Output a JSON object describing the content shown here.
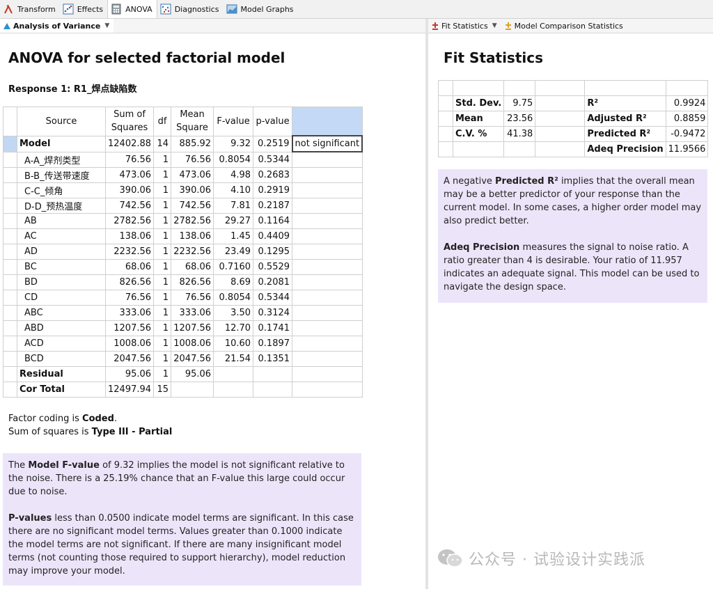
{
  "toolbar": {
    "items": [
      {
        "label": "Transform",
        "icon": "lambda-icon"
      },
      {
        "label": "Effects",
        "icon": "effects-plot-icon"
      },
      {
        "label": "ANOVA",
        "icon": "calculator-icon"
      },
      {
        "label": "Diagnostics",
        "icon": "diagnostics-icon"
      },
      {
        "label": "Model Graphs",
        "icon": "model-graphs-icon"
      }
    ],
    "active": "ANOVA"
  },
  "left_tab": {
    "label": "Analysis of Variance"
  },
  "right_tabs": [
    {
      "label": "Fit Statistics"
    },
    {
      "label": "Model Comparison Statistics"
    }
  ],
  "anova": {
    "title": "ANOVA for selected factorial model",
    "response": "Response 1: R1_焊点缺陷数",
    "headers": {
      "source": "Source",
      "ss_line1": "Sum of",
      "ss_line2": "Squares",
      "df": "df",
      "ms_line1": "Mean",
      "ms_line2": "Square",
      "f": "F-value",
      "p": "p-value"
    },
    "rows": [
      {
        "source": "Model",
        "ss": "12402.88",
        "df": "14",
        "ms": "885.92",
        "f": "9.32",
        "p": "0.2519",
        "sig": "not significant"
      },
      {
        "source": "A-A_焊剂类型",
        "ss": "76.56",
        "df": "1",
        "ms": "76.56",
        "f": "0.8054",
        "p": "0.5344",
        "sig": ""
      },
      {
        "source": "B-B_传送带速度",
        "ss": "473.06",
        "df": "1",
        "ms": "473.06",
        "f": "4.98",
        "p": "0.2683",
        "sig": ""
      },
      {
        "source": "C-C_倾角",
        "ss": "390.06",
        "df": "1",
        "ms": "390.06",
        "f": "4.10",
        "p": "0.2919",
        "sig": ""
      },
      {
        "source": "D-D_预热温度",
        "ss": "742.56",
        "df": "1",
        "ms": "742.56",
        "f": "7.81",
        "p": "0.2187",
        "sig": ""
      },
      {
        "source": "AB",
        "ss": "2782.56",
        "df": "1",
        "ms": "2782.56",
        "f": "29.27",
        "p": "0.1164",
        "sig": ""
      },
      {
        "source": "AC",
        "ss": "138.06",
        "df": "1",
        "ms": "138.06",
        "f": "1.45",
        "p": "0.4409",
        "sig": ""
      },
      {
        "source": "AD",
        "ss": "2232.56",
        "df": "1",
        "ms": "2232.56",
        "f": "23.49",
        "p": "0.1295",
        "sig": ""
      },
      {
        "source": "BC",
        "ss": "68.06",
        "df": "1",
        "ms": "68.06",
        "f": "0.7160",
        "p": "0.5529",
        "sig": ""
      },
      {
        "source": "BD",
        "ss": "826.56",
        "df": "1",
        "ms": "826.56",
        "f": "8.69",
        "p": "0.2081",
        "sig": ""
      },
      {
        "source": "CD",
        "ss": "76.56",
        "df": "1",
        "ms": "76.56",
        "f": "0.8054",
        "p": "0.5344",
        "sig": ""
      },
      {
        "source": "ABC",
        "ss": "333.06",
        "df": "1",
        "ms": "333.06",
        "f": "3.50",
        "p": "0.3124",
        "sig": ""
      },
      {
        "source": "ABD",
        "ss": "1207.56",
        "df": "1",
        "ms": "1207.56",
        "f": "12.70",
        "p": "0.1741",
        "sig": ""
      },
      {
        "source": "ACD",
        "ss": "1008.06",
        "df": "1",
        "ms": "1008.06",
        "f": "10.60",
        "p": "0.1897",
        "sig": ""
      },
      {
        "source": "BCD",
        "ss": "2047.56",
        "df": "1",
        "ms": "2047.56",
        "f": "21.54",
        "p": "0.1351",
        "sig": ""
      },
      {
        "source": "Residual",
        "ss": "95.06",
        "df": "1",
        "ms": "95.06",
        "f": "",
        "p": "",
        "sig": ""
      },
      {
        "source": "Cor Total",
        "ss": "12497.94",
        "df": "15",
        "ms": "",
        "f": "",
        "p": "",
        "sig": ""
      }
    ],
    "coding": {
      "prefix": "Factor coding is ",
      "value": "Coded",
      "suffix": "."
    },
    "sstype": {
      "prefix": "Sum of squares is ",
      "value": "Type III - Partial"
    },
    "note_model": {
      "pre": "The ",
      "bold": "Model F-value",
      "text": " of 9.32 implies the model is not significant relative to the noise. There is a 25.19% chance that an F-value this large could occur due to noise."
    },
    "note_p": {
      "bold": "P-values",
      "text": " less than 0.0500 indicate model terms are significant. In this case there are no significant model terms. Values greater than 0.1000 indicate the model terms are not significant. If there are many insignificant model terms (not counting those required to support hierarchy), model reduction may improve your model."
    }
  },
  "fit": {
    "title": "Fit Statistics",
    "rows": [
      {
        "l1": "Std. Dev.",
        "v1": "9.75",
        "l2": "R²",
        "v2": "0.9924"
      },
      {
        "l1": "Mean",
        "v1": "23.56",
        "l2": "Adjusted R²",
        "v2": "0.8859"
      },
      {
        "l1": "C.V. %",
        "v1": "41.38",
        "l2": "Predicted R²",
        "v2": "-0.9472"
      },
      {
        "l1": "",
        "v1": "",
        "l2": "Adeq Precision",
        "v2": "11.9566"
      }
    ],
    "note_pred": {
      "pre": "A negative ",
      "bold": "Predicted R²",
      "text": " implies that the overall mean may be a better predictor of your response than the current model. In some cases, a higher order model may also predict better."
    },
    "note_adeq": {
      "bold": "Adeq Precision",
      "text": " measures the signal to noise ratio. A ratio greater than 4 is desirable. Your ratio of 11.957 indicates an adequate signal. This model can be used to navigate the design space."
    }
  },
  "watermark": {
    "text": "公众号 · 试验设计实践派",
    "icon": "wechat-icon"
  }
}
